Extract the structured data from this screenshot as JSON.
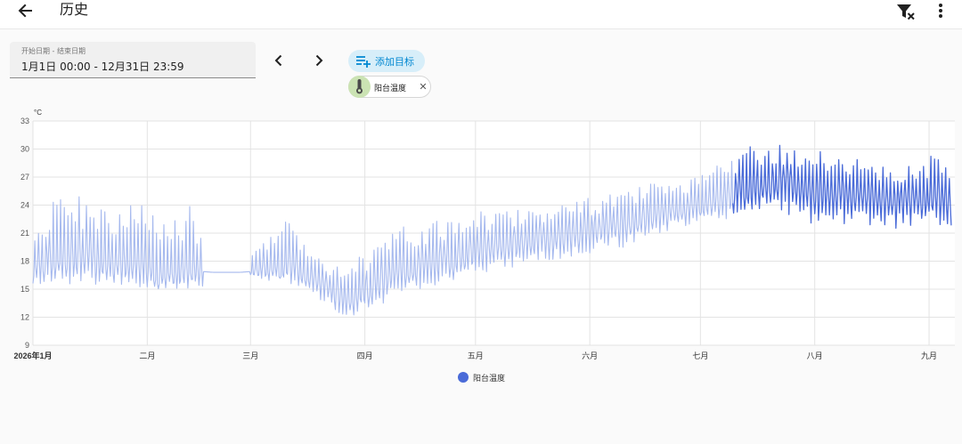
{
  "header": {
    "title": "历史"
  },
  "date_picker": {
    "label": "开始日期 - 结束日期",
    "value": "1月1日 00:00 - 12月31日 23:59"
  },
  "target": {
    "add_label": "添加目标"
  },
  "chip": {
    "label": "阳台温度"
  },
  "colors": {
    "series": "#4a6bd8",
    "series_light": "#a6b9ee",
    "chip_avatar": "#cbe3b3",
    "accent": "#0288d1"
  },
  "chart_data": {
    "type": "line",
    "ylabel": "°C",
    "ylim": [
      9,
      33
    ],
    "y_ticks": [
      9,
      12,
      15,
      18,
      21,
      24,
      27,
      30,
      33
    ],
    "x_tick_labels": [
      "2026年1月",
      "二月",
      "三月",
      "四月",
      "五月",
      "六月",
      "七月",
      "八月",
      "九月"
    ],
    "x_tick_dates": [
      "2026-01-01",
      "2026-02-01",
      "2026-03-01",
      "2026-04-01",
      "2026-05-01",
      "2026-06-01",
      "2026-07-01",
      "2026-08-01",
      "2026-09-01"
    ],
    "grid": true,
    "legend_position": "bottom",
    "series": [
      {
        "name": "阳台温度",
        "x": [
          "2026-01-01",
          "2026-01-08",
          "2026-01-15",
          "2026-01-22",
          "2026-01-29",
          "2026-02-05",
          "2026-02-12",
          "2026-02-19",
          "2026-02-26",
          "2026-03-05",
          "2026-03-12",
          "2026-03-19",
          "2026-03-26",
          "2026-04-02",
          "2026-04-09",
          "2026-04-16",
          "2026-04-23",
          "2026-04-30",
          "2026-05-07",
          "2026-05-14",
          "2026-05-21",
          "2026-05-28",
          "2026-06-04",
          "2026-06-11",
          "2026-06-18",
          "2026-06-25",
          "2026-07-02",
          "2026-07-09",
          "2026-07-16",
          "2026-07-23",
          "2026-07-30",
          "2026-08-06",
          "2026-08-13",
          "2026-08-20",
          "2026-08-27",
          "2026-09-03",
          "2026-09-07"
        ],
        "mean": [
          17.2,
          18.5,
          18.3,
          18.0,
          17.2,
          16.5,
          17.0,
          16.8,
          16.8,
          17.0,
          17.5,
          16.0,
          14.0,
          15.0,
          16.5,
          17.5,
          18.0,
          18.8,
          19.5,
          20.0,
          20.5,
          21.0,
          21.5,
          22.0,
          22.8,
          23.5,
          24.0,
          25.0,
          26.0,
          26.5,
          25.5,
          25.5,
          25.0,
          24.8,
          24.5,
          25.0,
          24.0
        ],
        "min": [
          15.0,
          15.5,
          15.5,
          15.2,
          15.0,
          15.0,
          15.0,
          15.5,
          16.8,
          16.0,
          15.5,
          14.0,
          12.0,
          12.5,
          14.0,
          15.0,
          15.5,
          16.5,
          17.0,
          17.5,
          18.0,
          18.5,
          19.0,
          19.5,
          20.5,
          21.5,
          22.0,
          22.5,
          23.5,
          23.0,
          22.0,
          22.0,
          22.0,
          21.5,
          21.5,
          22.0,
          21.5
        ],
        "max": [
          22.0,
          25.0,
          25.0,
          23.5,
          24.5,
          22.0,
          24.5,
          18.5,
          16.8,
          21.5,
          22.5,
          19.0,
          17.5,
          19.5,
          21.5,
          22.0,
          22.5,
          24.0,
          23.5,
          24.0,
          24.0,
          24.5,
          25.0,
          25.5,
          26.5,
          26.0,
          27.5,
          29.0,
          31.0,
          30.5,
          29.5,
          30.0,
          29.0,
          28.0,
          28.5,
          29.5,
          27.5
        ]
      }
    ]
  }
}
